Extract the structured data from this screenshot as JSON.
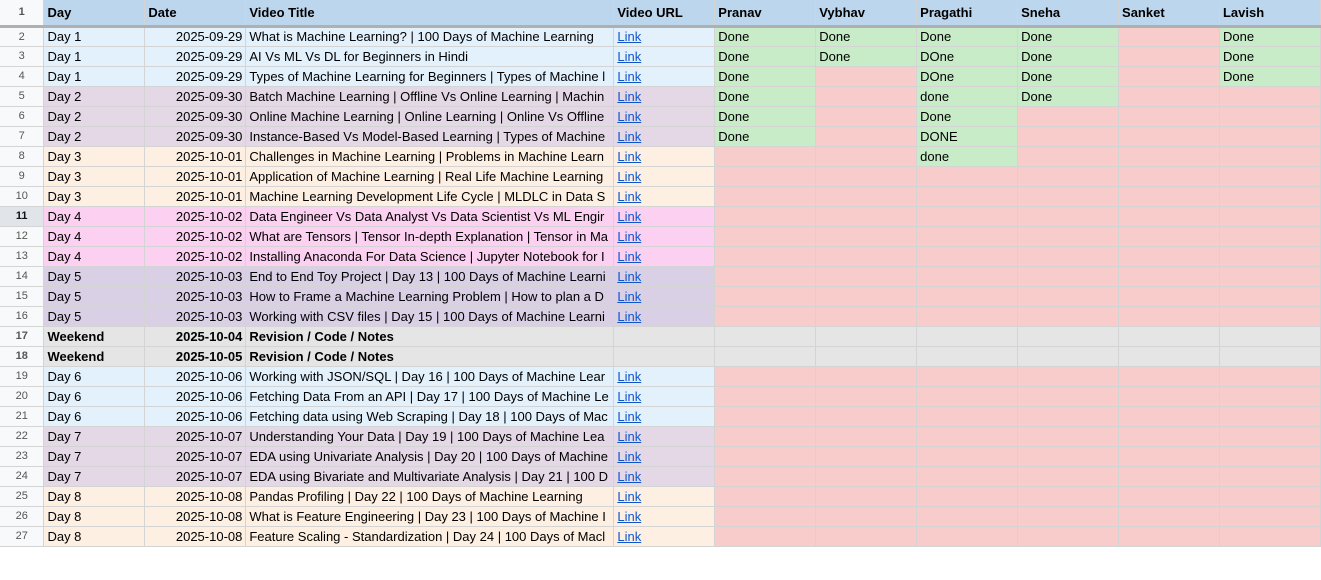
{
  "headers": [
    "Day",
    "Date",
    "Video Title",
    "Video URL",
    "Pranav",
    "Vybhav",
    "Pragathi",
    "Sneha",
    "Sanket",
    "Lavish"
  ],
  "colors": {
    "light_blue": "#e3f1fc",
    "light_purple": "#e4d8e6",
    "light_orange": "#fdf0e2",
    "pink": "#fbd0f0",
    "lavender": "#d9d0e6",
    "grey": "#e5e5e5",
    "done_green": "#c8ecc8",
    "none_red": "#f9cccc"
  },
  "rows": [
    {
      "n": "2",
      "day": "Day 1",
      "date": "2025-09-29",
      "title": "What is Machine Learning? | 100 Days of Machine Learning",
      "url": "Link",
      "color": "light_blue",
      "s": [
        "Done",
        "Done",
        "Done",
        "Done",
        "",
        "Done"
      ]
    },
    {
      "n": "3",
      "day": "Day 1",
      "date": "2025-09-29",
      "title": "AI Vs ML Vs DL for Beginners in Hindi",
      "url": "Link",
      "color": "light_blue",
      "s": [
        "Done",
        "Done",
        "DOne",
        "Done",
        "",
        "Done"
      ]
    },
    {
      "n": "4",
      "day": "Day 1",
      "date": "2025-09-29",
      "title": "Types of Machine Learning for Beginners | Types of Machine l",
      "url": "Link",
      "color": "light_blue",
      "s": [
        "Done",
        "",
        "DOne",
        "Done",
        "",
        "Done"
      ]
    },
    {
      "n": "5",
      "day": "Day 2",
      "date": "2025-09-30",
      "title": "Batch Machine Learning | Offline Vs Online Learning | Machin",
      "url": "Link",
      "color": "light_purple",
      "s": [
        "Done",
        "",
        "done",
        "Done",
        "",
        ""
      ]
    },
    {
      "n": "6",
      "day": "Day 2",
      "date": "2025-09-30",
      "title": "Online Machine Learning | Online Learning | Online Vs Offline",
      "url": "Link",
      "color": "light_purple",
      "s": [
        "Done",
        "",
        "Done",
        "",
        "",
        ""
      ]
    },
    {
      "n": "7",
      "day": "Day 2",
      "date": "2025-09-30",
      "title": "Instance-Based Vs Model-Based Learning | Types of Machine",
      "url": "Link",
      "color": "light_purple",
      "s": [
        "Done",
        "",
        "DONE",
        "",
        "",
        ""
      ]
    },
    {
      "n": "8",
      "day": "Day 3",
      "date": "2025-10-01",
      "title": "Challenges in Machine Learning | Problems in Machine Learn",
      "url": "Link",
      "color": "light_orange",
      "s": [
        "",
        "",
        "done",
        "",
        "",
        ""
      ]
    },
    {
      "n": "9",
      "day": "Day 3",
      "date": "2025-10-01",
      "title": "Application of Machine Learning | Real Life Machine Learning",
      "url": "Link",
      "color": "light_orange",
      "s": [
        "",
        "",
        "",
        "",
        "",
        ""
      ]
    },
    {
      "n": "10",
      "day": "Day 3",
      "date": "2025-10-01",
      "title": "Machine Learning Development Life Cycle | MLDLC in Data S",
      "url": "Link",
      "color": "light_orange",
      "s": [
        "",
        "",
        "",
        "",
        "",
        ""
      ]
    },
    {
      "n": "11",
      "day": "Day 4",
      "date": "2025-10-02",
      "title": "Data Engineer Vs Data Analyst Vs Data Scientist Vs ML Engir",
      "url": "Link",
      "color": "pink",
      "s": [
        "",
        "",
        "",
        "",
        "",
        ""
      ]
    },
    {
      "n": "12",
      "day": "Day 4",
      "date": "2025-10-02",
      "title": "What are Tensors | Tensor In-depth Explanation | Tensor in Ma",
      "url": "Link",
      "color": "pink",
      "s": [
        "",
        "",
        "",
        "",
        "",
        ""
      ]
    },
    {
      "n": "13",
      "day": "Day 4",
      "date": "2025-10-02",
      "title": "Installing Anaconda For Data Science | Jupyter Notebook for I",
      "url": "Link",
      "color": "pink",
      "s": [
        "",
        "",
        "",
        "",
        "",
        ""
      ]
    },
    {
      "n": "14",
      "day": "Day 5",
      "date": "2025-10-03",
      "title": "End to End Toy Project | Day 13 | 100 Days of Machine Learni",
      "url": "Link",
      "color": "lavender",
      "s": [
        "",
        "",
        "",
        "",
        "",
        ""
      ]
    },
    {
      "n": "15",
      "day": "Day 5",
      "date": "2025-10-03",
      "title": "How to Frame a Machine Learning Problem | How to plan a D",
      "url": "Link",
      "color": "lavender",
      "s": [
        "",
        "",
        "",
        "",
        "",
        ""
      ]
    },
    {
      "n": "16",
      "day": "Day 5",
      "date": "2025-10-03",
      "title": "Working with CSV files | Day 15 | 100 Days of Machine Learni",
      "url": "Link",
      "color": "lavender",
      "s": [
        "",
        "",
        "",
        "",
        "",
        ""
      ]
    },
    {
      "n": "17",
      "day": "Weekend",
      "date": "2025-10-04",
      "title": "Revision / Code / Notes",
      "url": "",
      "color": "grey",
      "weekend": true,
      "s": [
        "",
        "",
        "",
        "",
        "",
        ""
      ]
    },
    {
      "n": "18",
      "day": "Weekend",
      "date": "2025-10-05",
      "title": "Revision / Code / Notes",
      "url": "",
      "color": "grey",
      "weekend": true,
      "s": [
        "",
        "",
        "",
        "",
        "",
        ""
      ]
    },
    {
      "n": "19",
      "day": "Day 6",
      "date": "2025-10-06",
      "title": "Working with JSON/SQL | Day 16 | 100 Days of Machine Lear",
      "url": "Link",
      "color": "light_blue",
      "s": [
        "",
        "",
        "",
        "",
        "",
        ""
      ]
    },
    {
      "n": "20",
      "day": "Day 6",
      "date": "2025-10-06",
      "title": "Fetching Data From an API | Day 17 | 100 Days of Machine Le",
      "url": "Link",
      "color": "light_blue",
      "s": [
        "",
        "",
        "",
        "",
        "",
        ""
      ]
    },
    {
      "n": "21",
      "day": "Day 6",
      "date": "2025-10-06",
      "title": "Fetching data using Web Scraping | Day 18 | 100 Days of Mac",
      "url": "Link",
      "color": "light_blue",
      "s": [
        "",
        "",
        "",
        "",
        "",
        ""
      ]
    },
    {
      "n": "22",
      "day": "Day 7",
      "date": "2025-10-07",
      "title": "Understanding Your Data | Day 19 | 100 Days of Machine Lea",
      "url": "Link",
      "color": "light_purple",
      "s": [
        "",
        "",
        "",
        "",
        "",
        ""
      ]
    },
    {
      "n": "23",
      "day": "Day 7",
      "date": "2025-10-07",
      "title": "EDA using Univariate Analysis | Day 20 | 100 Days of Machine",
      "url": "Link",
      "color": "light_purple",
      "s": [
        "",
        "",
        "",
        "",
        "",
        ""
      ]
    },
    {
      "n": "24",
      "day": "Day 7",
      "date": "2025-10-07",
      "title": "EDA using Bivariate and Multivariate Analysis | Day 21 | 100 D",
      "url": "Link",
      "color": "light_purple",
      "s": [
        "",
        "",
        "",
        "",
        "",
        ""
      ]
    },
    {
      "n": "25",
      "day": "Day 8",
      "date": "2025-10-08",
      "title": "Pandas Profiling | Day 22 | 100 Days of Machine Learning",
      "url": "Link",
      "color": "light_orange",
      "s": [
        "",
        "",
        "",
        "",
        "",
        ""
      ]
    },
    {
      "n": "26",
      "day": "Day 8",
      "date": "2025-10-08",
      "title": "What is Feature Engineering | Day 23 | 100 Days of Machine I",
      "url": "Link",
      "color": "light_orange",
      "s": [
        "",
        "",
        "",
        "",
        "",
        ""
      ]
    },
    {
      "n": "27",
      "day": "Day 8",
      "date": "2025-10-08",
      "title": "Feature Scaling - Standardization | Day 24 | 100 Days of Macl",
      "url": "Link",
      "color": "light_orange",
      "s": [
        "",
        "",
        "",
        "",
        "",
        ""
      ]
    }
  ]
}
